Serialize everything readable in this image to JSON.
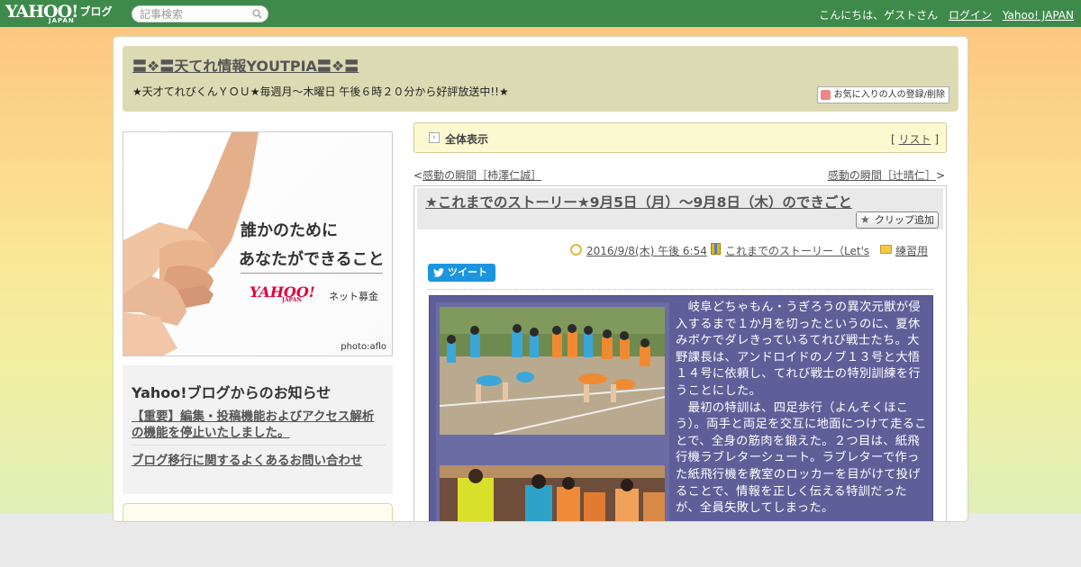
{
  "topbar": {
    "logo_text": "YAHOO!",
    "logo_sub": "JAPAN",
    "logo_blog": "ブログ",
    "search_placeholder": "記事検索",
    "greeting": "こんにちは、ゲストさん",
    "login_label": "ログイン",
    "yahoo_japan_label": "Yahoo! JAPAN"
  },
  "blog": {
    "title": "〓❖〓天てれ情報YOUTPIA〓❖〓",
    "description": "★天才てれびくんＹＯＵ★毎週月～木曜日 午後６時２０分から好評放送中!!★",
    "fav_button_label": "お気に入りの人の登録/削除"
  },
  "banner": {
    "line1": "誰かのために",
    "line2": "あなたができること",
    "logo": "YAHOO!",
    "logo_sub": "JAPAN",
    "tag": "ネット募金",
    "credit": "photo:aflo"
  },
  "notice": {
    "title": "Yahoo!ブログからのお知らせ",
    "items": [
      "【重要】編集・投稿機能およびアクセス解析の機能を停止いたしました。",
      "ブログ移行に関するよくあるお問い合わせ"
    ]
  },
  "allbar": {
    "label": "全体表示",
    "bracket_open": "[",
    "list_label": "リスト",
    "bracket_close": "]"
  },
  "nav": {
    "prev_prefix": "<",
    "prev_label": "感動の瞬間［柿澤仁誠］",
    "next_label": "感動の瞬間［辻晴仁］",
    "next_suffix": ">"
  },
  "article": {
    "title": "★これまでのストーリー★9月5日（月）～9月8日（木）のできごと",
    "clip_label": "クリップ追加",
    "date": "2016/9/8(木) 午後 6:54",
    "theme": "これまでのストーリー（Let's",
    "folder": "練習用",
    "tweet_label": "ツイート",
    "paragraph1": "　岐阜どちゃもん・うぎろうの異次元獣が侵入するまで１か月を切ったというのに、夏休みボケでダレきっているてれび戦士たち。大野課長は、アンドロイドのノブ１３号と大悟１４号に依頼し、てれび戦士の特別訓練を行うことにした。",
    "paragraph2": "　最初の特訓は、四足歩行（よんそくほこう）。両手と両足を交互に地面につけて走ることで、全身の筋肉を鍛えた。２つ目は、紙飛行機ラブレターシュート。ラブレターで作った紙飛行機を教室のロッカーを目がけて投げることで、情報を正しく伝える特訓だったが、全員失敗してしまった。"
  },
  "colors": {
    "topbar": "#3e8a4b",
    "header_bg": "#dcdab3",
    "content_box": "#5e5f99",
    "tweet": "#1b95e0"
  }
}
